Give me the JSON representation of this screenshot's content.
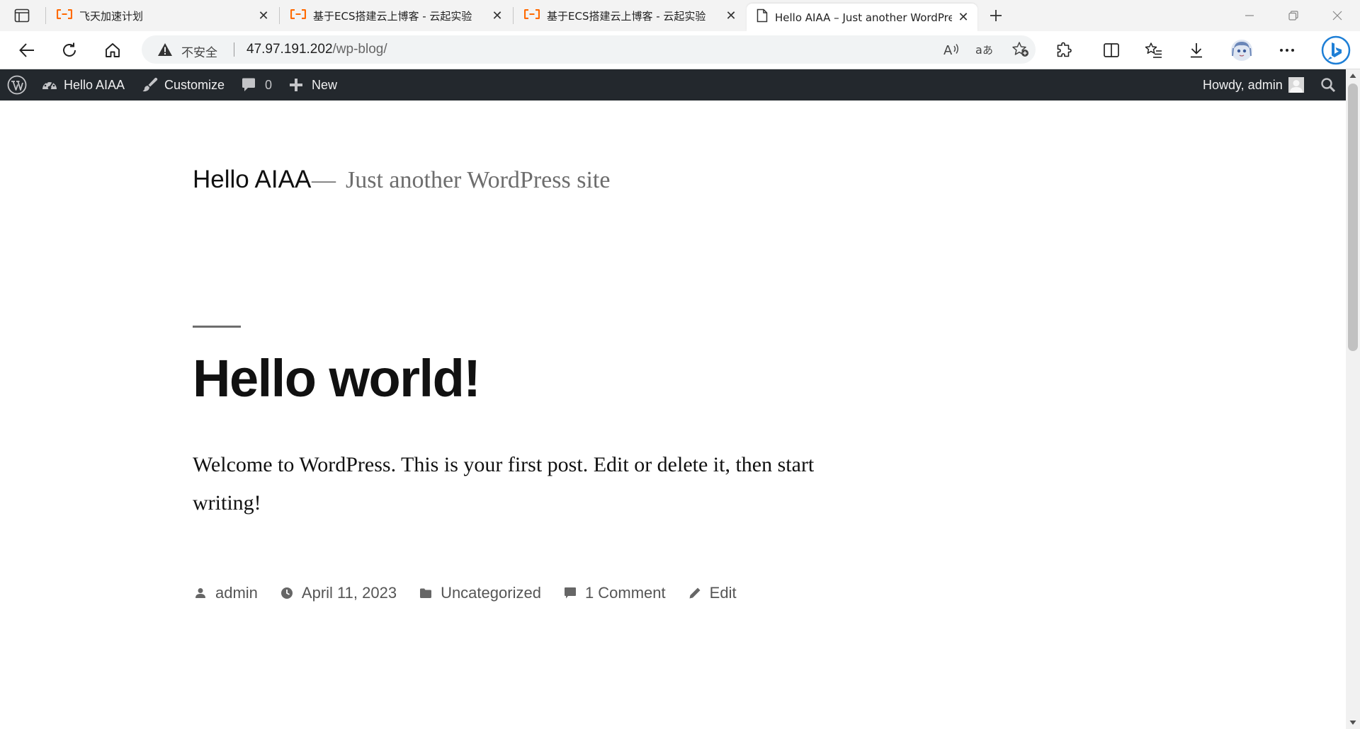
{
  "browser": {
    "tabs": [
      {
        "title": "飞天加速计划",
        "icon": "aliyun-logo-icon",
        "active": false
      },
      {
        "title": "基于ECS搭建云上博客 - 云起实验",
        "icon": "aliyun-logo-icon",
        "active": false
      },
      {
        "title": "基于ECS搭建云上博客 - 云起实验",
        "icon": "aliyun-logo-icon",
        "active": false
      },
      {
        "title": "Hello AIAA – Just another WordPress site",
        "icon": "page-icon",
        "active": true
      }
    ],
    "security_label": "不安全",
    "url_host": "47.97.191.202",
    "url_path": "/wp-blog/",
    "accent_color": "#0078d4"
  },
  "adminbar": {
    "site_name": "Hello AIAA",
    "customize": "Customize",
    "comments_count": "0",
    "new_label": "New",
    "howdy": "Howdy, admin"
  },
  "site": {
    "title": "Hello AIAA",
    "separator": "—",
    "description": "Just another WordPress site"
  },
  "post": {
    "title": "Hello world!",
    "body": "Welcome to WordPress. This is your first post. Edit or delete it, then start writing!",
    "meta": {
      "author": "admin",
      "date": "April 11, 2023",
      "category": "Uncategorized",
      "comments": "1 Comment",
      "edit": "Edit"
    }
  }
}
